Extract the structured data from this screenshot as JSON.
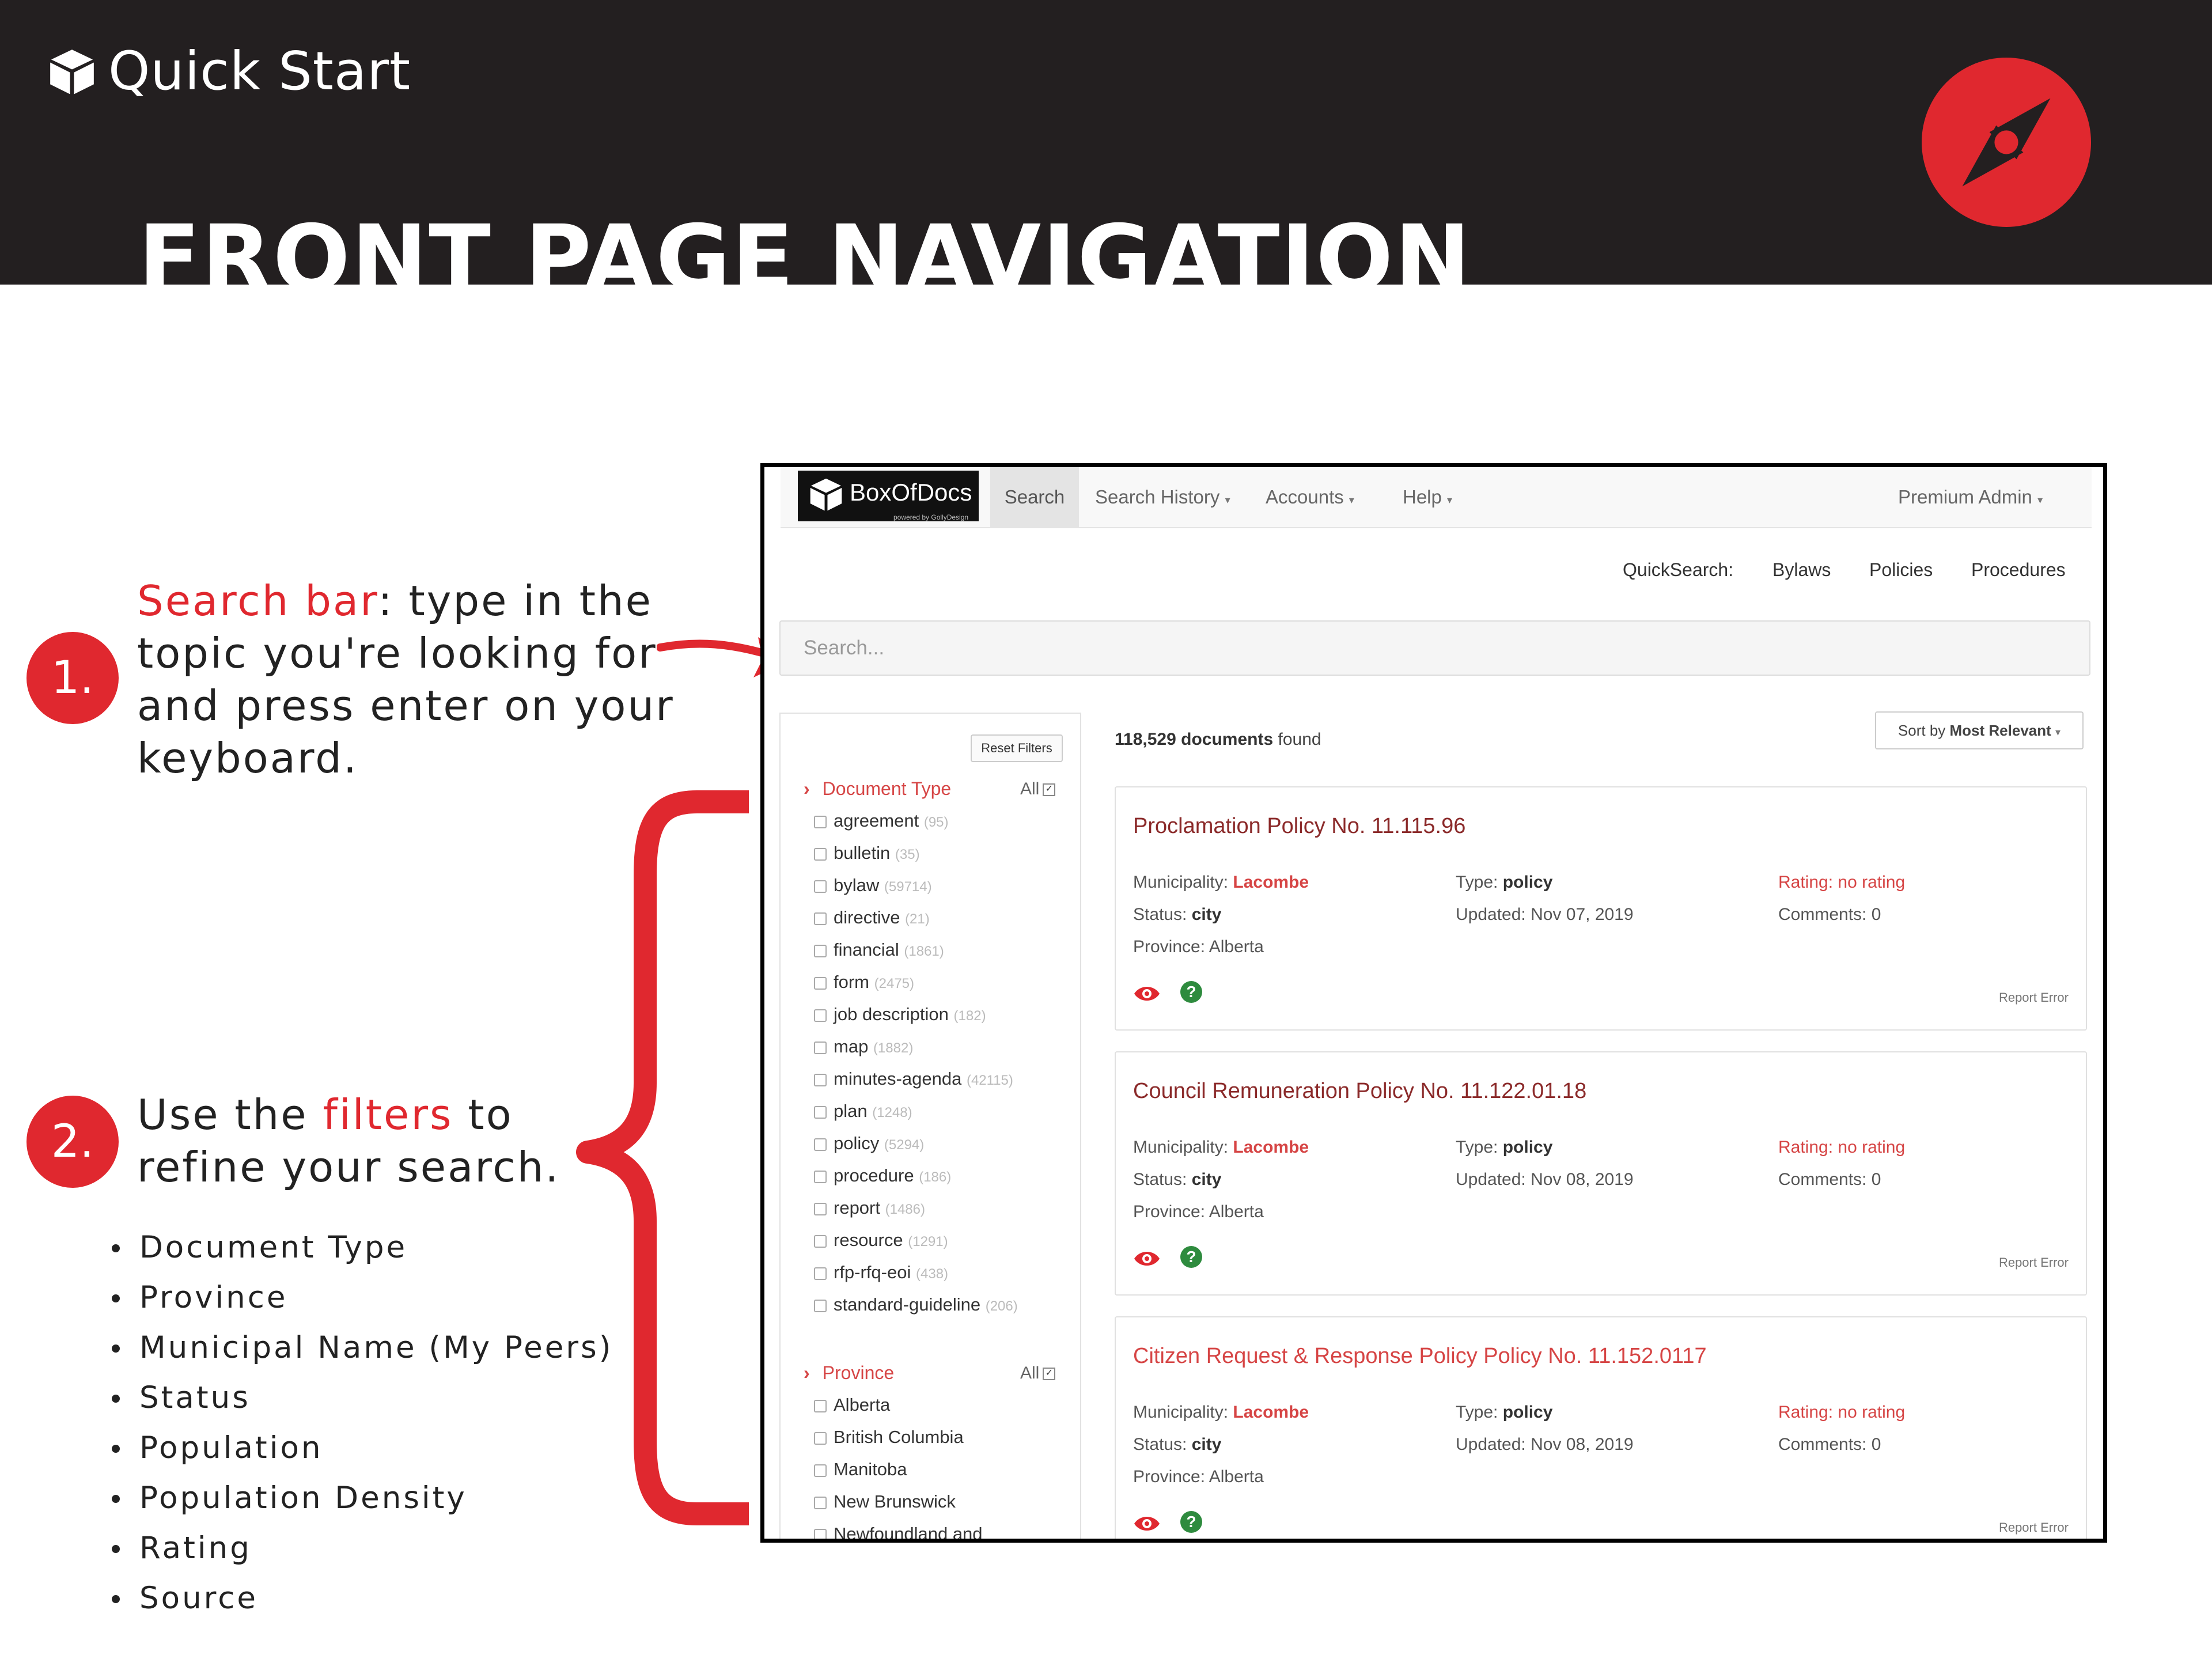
{
  "header": {
    "app_label": "Quick Start",
    "page_title": "FRONT PAGE NAVIGATION"
  },
  "steps": [
    {
      "number": "1.",
      "highlight": "Search bar",
      "lines": [
        ": type in the",
        "topic you're looking for",
        "and press enter on your",
        "keyboard."
      ]
    },
    {
      "number": "2.",
      "prefix": "Use the ",
      "highlight": "filters",
      "suffix": " to",
      "line2": "refine your search."
    }
  ],
  "filter_bullets": [
    "Document Type",
    "Province",
    "Municipal Name (My Peers)",
    "Status",
    "Population",
    "Population Density",
    "Rating",
    "Source"
  ],
  "colors": {
    "accent": "#e0282f",
    "header_bg": "#231f20",
    "link_red": "#d64545",
    "green": "#2e8b3e"
  },
  "app": {
    "logo_text": "BoxOfDocs",
    "logo_sub": "powered by GollyDesign",
    "nav": {
      "search": "Search",
      "history": "Search History",
      "accounts": "Accounts",
      "help": "Help",
      "user": "Premium Admin",
      "caret": "▾"
    },
    "quicksearch": {
      "label": "QuickSearch:",
      "links": [
        "Bylaws",
        "Policies",
        "Procedures"
      ]
    },
    "search_placeholder": "Search...",
    "reset_filters": "Reset Filters",
    "doc_type_heading": "Document Type",
    "province_heading": "Province",
    "all_label": "All",
    "doc_types": [
      {
        "name": "agreement",
        "count": "(95)"
      },
      {
        "name": "bulletin",
        "count": "(35)"
      },
      {
        "name": "bylaw",
        "count": "(59714)"
      },
      {
        "name": "directive",
        "count": "(21)"
      },
      {
        "name": "financial",
        "count": "(1861)"
      },
      {
        "name": "form",
        "count": "(2475)"
      },
      {
        "name": "job description",
        "count": "(182)"
      },
      {
        "name": "map",
        "count": "(1882)"
      },
      {
        "name": "minutes-agenda",
        "count": "(42115)"
      },
      {
        "name": "plan",
        "count": "(1248)"
      },
      {
        "name": "policy",
        "count": "(5294)"
      },
      {
        "name": "procedure",
        "count": "(186)"
      },
      {
        "name": "report",
        "count": "(1486)"
      },
      {
        "name": "resource",
        "count": "(1291)"
      },
      {
        "name": "rfp-rfq-eoi",
        "count": "(438)"
      },
      {
        "name": "standard-guideline",
        "count": "(206)"
      }
    ],
    "provinces": [
      "Alberta",
      "British Columbia",
      "Manitoba",
      "New Brunswick",
      "Newfoundland and"
    ],
    "results_count": "118,529 documents",
    "results_suffix": " found",
    "sort_prefix": "Sort by ",
    "sort_value": "Most Relevant",
    "labels": {
      "municipality": "Municipality: ",
      "type": "Type: ",
      "status": "Status: ",
      "updated": "Updated: ",
      "province": "Province: ",
      "rating": "Rating: no rating",
      "comments": "Comments: 0",
      "report_error": "Report Error"
    },
    "results": [
      {
        "title": "Proclamation Policy No. 11.115.96",
        "municipality": "Lacombe",
        "type": "policy",
        "status": "city",
        "updated": "Nov 07, 2019",
        "province": "Alberta"
      },
      {
        "title": "Council Remuneration Policy No. 11.122.01.18",
        "municipality": "Lacombe",
        "type": "policy",
        "status": "city",
        "updated": "Nov 08, 2019",
        "province": "Alberta"
      },
      {
        "title": "Citizen Request & Response Policy Policy No. 11.152.0117",
        "municipality": "Lacombe",
        "type": "policy",
        "status": "city",
        "updated": "Nov 08, 2019",
        "province": "Alberta"
      }
    ]
  }
}
